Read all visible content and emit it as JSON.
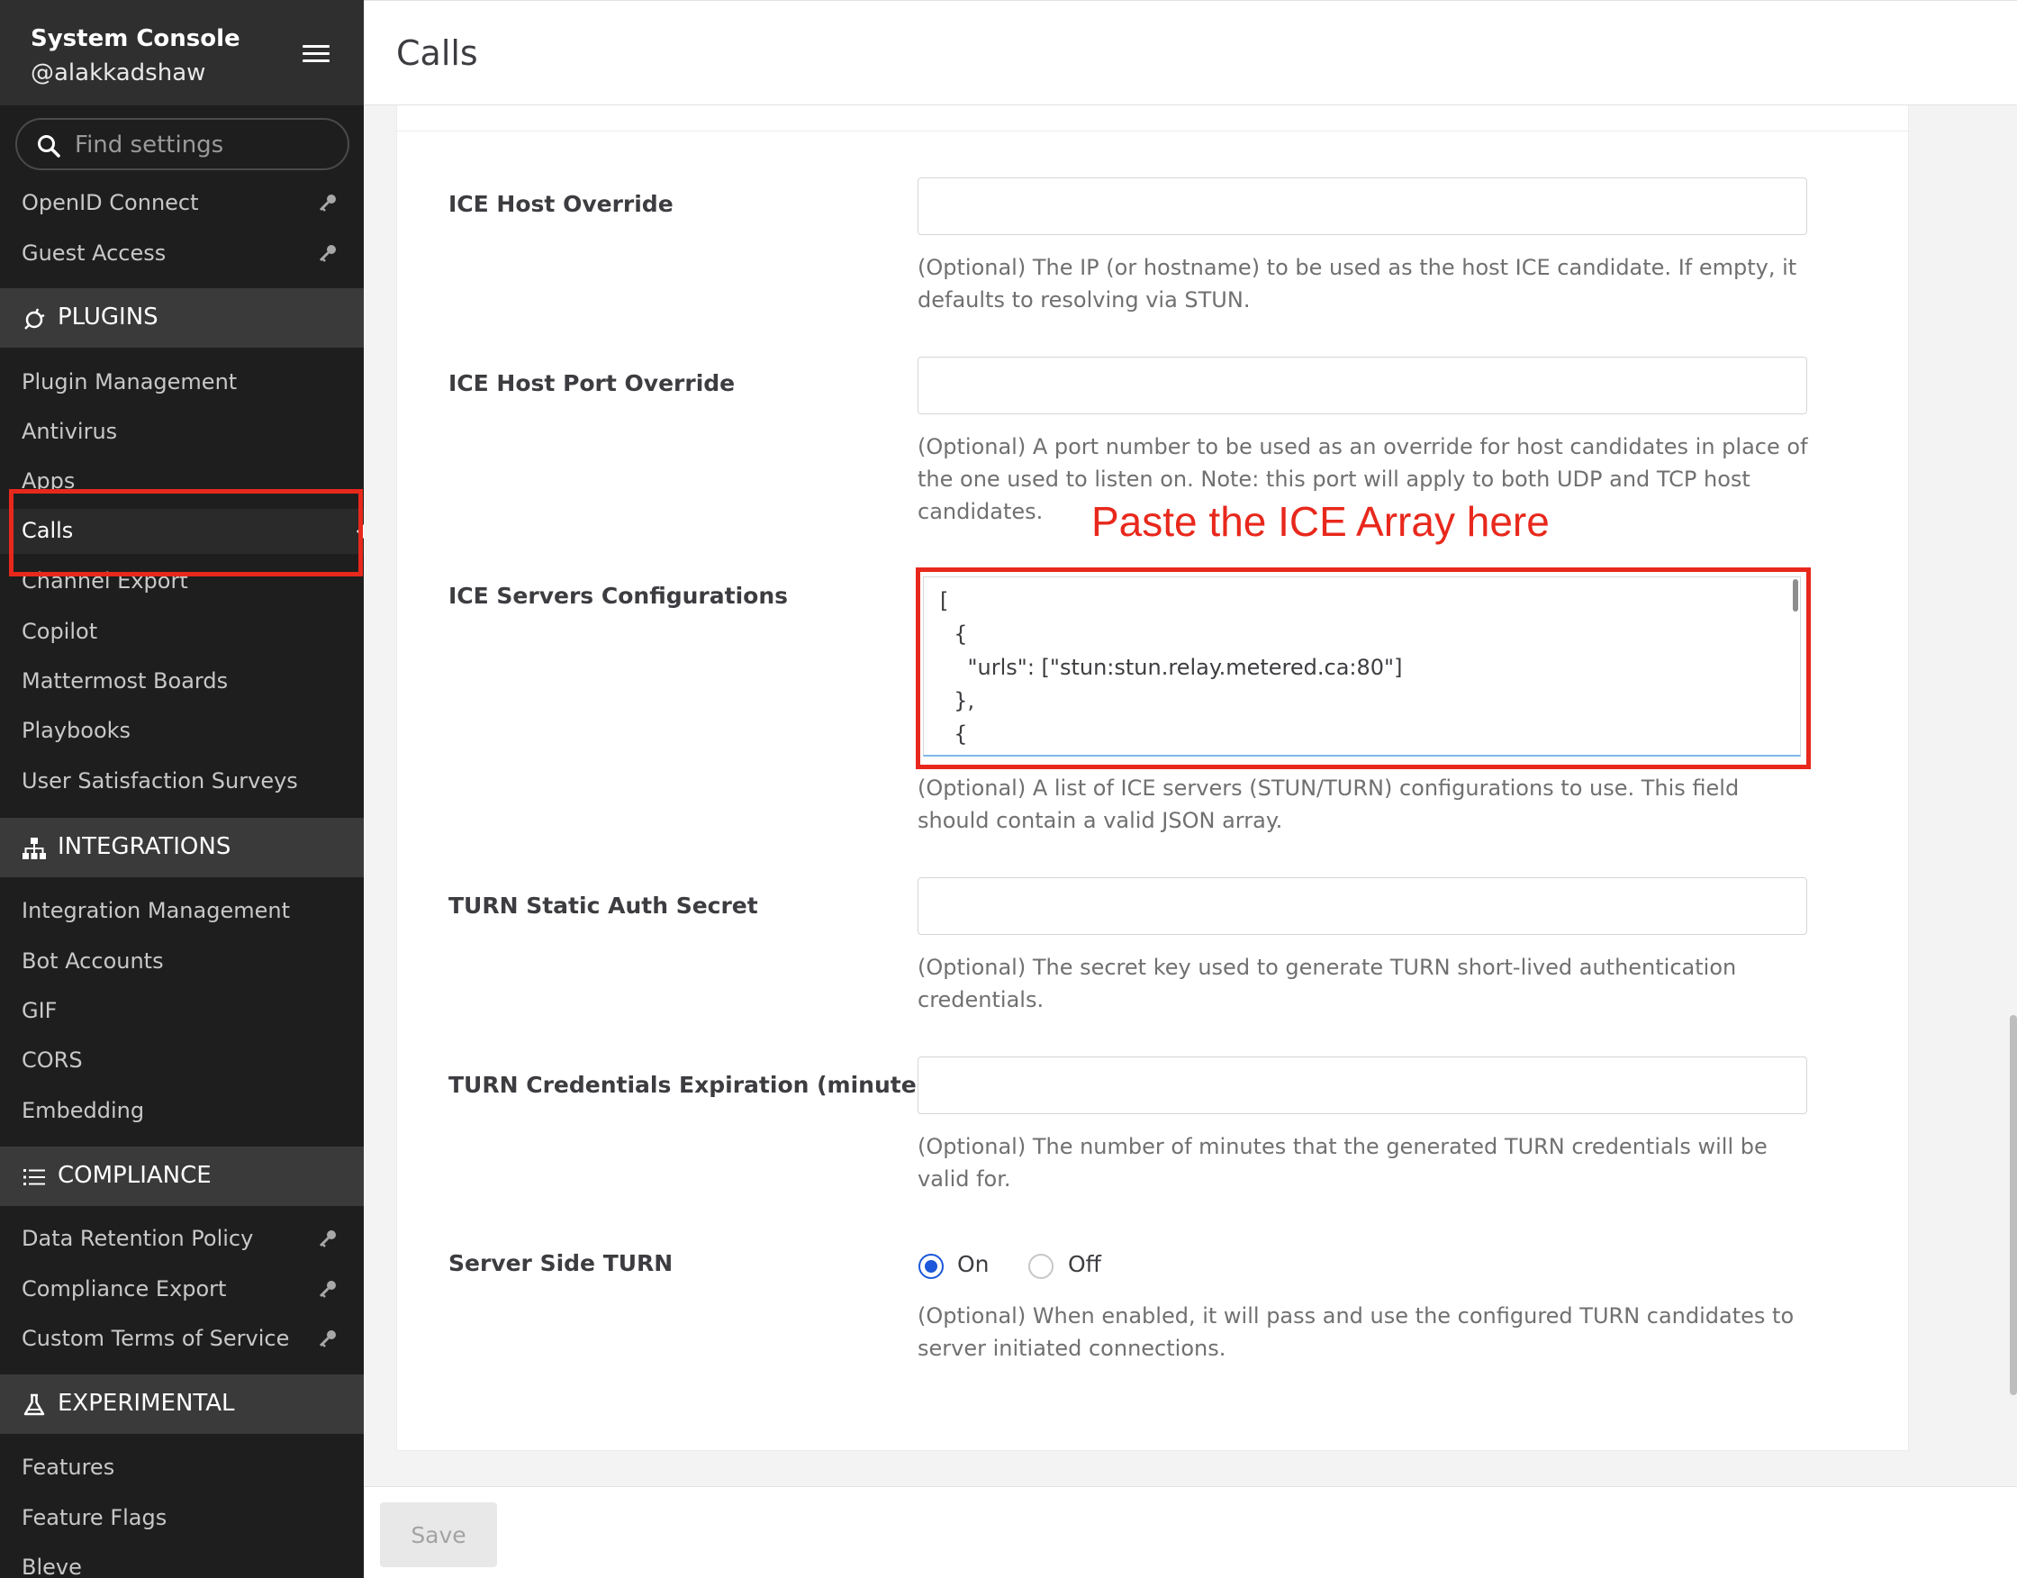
{
  "sidebar": {
    "title": "System Console",
    "username": "@alakkadshaw",
    "search_placeholder": "Find settings",
    "items_top": [
      {
        "label": "OpenID Connect",
        "locked": true
      },
      {
        "label": "Guest Access",
        "locked": true
      }
    ],
    "plugins": {
      "label": "PLUGINS",
      "items": [
        {
          "label": "Plugin Management"
        },
        {
          "label": "Antivirus"
        },
        {
          "label": "Apps"
        },
        {
          "label": "Calls",
          "active": true
        },
        {
          "label": "Channel Export"
        },
        {
          "label": "Copilot"
        },
        {
          "label": "Mattermost Boards"
        },
        {
          "label": "Playbooks"
        },
        {
          "label": "User Satisfaction Surveys"
        }
      ]
    },
    "integrations": {
      "label": "INTEGRATIONS",
      "items": [
        {
          "label": "Integration Management"
        },
        {
          "label": "Bot Accounts"
        },
        {
          "label": "GIF"
        },
        {
          "label": "CORS"
        },
        {
          "label": "Embedding"
        }
      ]
    },
    "compliance": {
      "label": "COMPLIANCE",
      "items": [
        {
          "label": "Data Retention Policy",
          "locked": true
        },
        {
          "label": "Compliance Export",
          "locked": true
        },
        {
          "label": "Custom Terms of Service",
          "locked": true
        }
      ]
    },
    "experimental": {
      "label": "EXPERIMENTAL",
      "items": [
        {
          "label": "Features"
        },
        {
          "label": "Feature Flags"
        },
        {
          "label": "Bleve"
        }
      ]
    }
  },
  "header": {
    "title": "Calls"
  },
  "settings": {
    "ice_host_override": {
      "label": "ICE Host Override",
      "value": "",
      "help": "(Optional) The IP (or hostname) to be used as the host ICE candidate. If empty, it defaults to resolving via STUN."
    },
    "ice_host_port_override": {
      "label": "ICE Host Port Override",
      "value": "",
      "help": "(Optional) A port number to be used as an override for host candidates in place of the one used to listen on. Note: this port will apply to both UDP and TCP host candidates."
    },
    "ice_servers": {
      "label": "ICE Servers Configurations",
      "value": "[\n  {\n    \"urls\": [\"stun:stun.relay.metered.ca:80\"]\n  },\n  {",
      "help": "(Optional) A list of ICE servers (STUN/TURN) configurations to use. This field should contain a valid JSON array."
    },
    "turn_static_auth_secret": {
      "label": "TURN Static Auth Secret",
      "value": "",
      "help": "(Optional) The secret key used to generate TURN short-lived authentication credentials."
    },
    "turn_credentials_expiration": {
      "label": "TURN Credentials Expiration (minutes)",
      "value": "",
      "help": "(Optional) The number of minutes that the generated TURN credentials will be valid for."
    },
    "server_side_turn": {
      "label": "Server Side TURN",
      "options": [
        "On",
        "Off"
      ],
      "selected": "On",
      "help": "(Optional) When enabled, it will pass and use the configured TURN candidates to server initiated connections."
    }
  },
  "annotation": {
    "text": "Paste the ICE Array here",
    "color": "#e8281c"
  },
  "footer": {
    "save_label": "Save"
  },
  "colors": {
    "accent": "#1c58d9",
    "sidebar_bg": "#1e1e1e",
    "section_bg": "#3a3a3a"
  }
}
